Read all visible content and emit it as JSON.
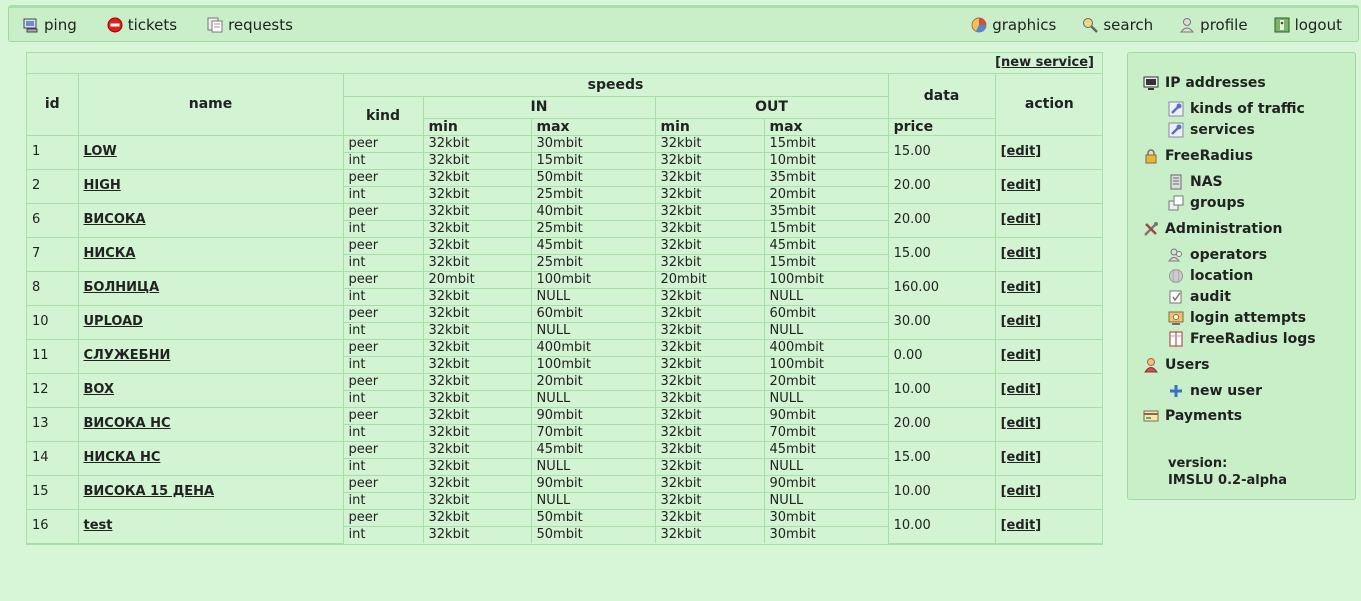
{
  "topnav": {
    "left": [
      {
        "label": "ping",
        "icon": "monitor-icon"
      },
      {
        "label": "tickets",
        "icon": "stop-icon"
      },
      {
        "label": "requests",
        "icon": "notes-icon"
      }
    ],
    "right": [
      {
        "label": "graphics",
        "icon": "chart-icon"
      },
      {
        "label": "search",
        "icon": "magnifier-icon"
      },
      {
        "label": "profile",
        "icon": "user-icon"
      },
      {
        "label": "logout",
        "icon": "exit-icon"
      }
    ]
  },
  "services": {
    "new_service_label": "[new service]",
    "headers": {
      "id": "id",
      "name": "name",
      "speeds": "speeds",
      "kind": "kind",
      "in": "IN",
      "out": "OUT",
      "min": "min",
      "max": "max",
      "data": "data",
      "price": "price",
      "action": "action"
    },
    "edit_label": "[edit]",
    "rows": [
      {
        "id": "1",
        "name": "LOW",
        "price": "15.00",
        "peer": [
          "peer",
          "32kbit",
          "30mbit",
          "32kbit",
          "15mbit"
        ],
        "int": [
          "int",
          "32kbit",
          "15mbit",
          "32kbit",
          "10mbit"
        ]
      },
      {
        "id": "2",
        "name": "HIGH",
        "price": "20.00",
        "peer": [
          "peer",
          "32kbit",
          "50mbit",
          "32kbit",
          "35mbit"
        ],
        "int": [
          "int",
          "32kbit",
          "25mbit",
          "32kbit",
          "20mbit"
        ]
      },
      {
        "id": "6",
        "name": "ВИСОКА",
        "price": "20.00",
        "peer": [
          "peer",
          "32kbit",
          "40mbit",
          "32kbit",
          "35mbit"
        ],
        "int": [
          "int",
          "32kbit",
          "25mbit",
          "32kbit",
          "15mbit"
        ]
      },
      {
        "id": "7",
        "name": "НИСКА",
        "price": "15.00",
        "peer": [
          "peer",
          "32kbit",
          "45mbit",
          "32kbit",
          "45mbit"
        ],
        "int": [
          "int",
          "32kbit",
          "25mbit",
          "32kbit",
          "15mbit"
        ]
      },
      {
        "id": "8",
        "name": "БОЛНИЦА",
        "price": "160.00",
        "peer": [
          "peer",
          "20mbit",
          "100mbit",
          "20mbit",
          "100mbit"
        ],
        "int": [
          "int",
          "32kbit",
          "NULL",
          "32kbit",
          "NULL"
        ]
      },
      {
        "id": "10",
        "name": "UPLOAD",
        "price": "30.00",
        "peer": [
          "peer",
          "32kbit",
          "60mbit",
          "32kbit",
          "60mbit"
        ],
        "int": [
          "int",
          "32kbit",
          "NULL",
          "32kbit",
          "NULL"
        ]
      },
      {
        "id": "11",
        "name": "СЛУЖЕБНИ",
        "price": "0.00",
        "peer": [
          "peer",
          "32kbit",
          "400mbit",
          "32kbit",
          "400mbit"
        ],
        "int": [
          "int",
          "32kbit",
          "100mbit",
          "32kbit",
          "100mbit"
        ]
      },
      {
        "id": "12",
        "name": "BOX",
        "price": "10.00",
        "peer": [
          "peer",
          "32kbit",
          "20mbit",
          "32kbit",
          "20mbit"
        ],
        "int": [
          "int",
          "32kbit",
          "NULL",
          "32kbit",
          "NULL"
        ]
      },
      {
        "id": "13",
        "name": "ВИСОКА НС",
        "price": "20.00",
        "peer": [
          "peer",
          "32kbit",
          "90mbit",
          "32kbit",
          "90mbit"
        ],
        "int": [
          "int",
          "32kbit",
          "70mbit",
          "32kbit",
          "70mbit"
        ]
      },
      {
        "id": "14",
        "name": "НИСКА НС",
        "price": "15.00",
        "peer": [
          "peer",
          "32kbit",
          "45mbit",
          "32kbit",
          "45mbit"
        ],
        "int": [
          "int",
          "32kbit",
          "NULL",
          "32kbit",
          "NULL"
        ]
      },
      {
        "id": "15",
        "name": "ВИСОКА 15 ДЕНА",
        "price": "10.00",
        "peer": [
          "peer",
          "32kbit",
          "90mbit",
          "32kbit",
          "90mbit"
        ],
        "int": [
          "int",
          "32kbit",
          "NULL",
          "32kbit",
          "NULL"
        ]
      },
      {
        "id": "16",
        "name": "test",
        "price": "10.00",
        "peer": [
          "peer",
          "32kbit",
          "50mbit",
          "32kbit",
          "30mbit"
        ],
        "int": [
          "int",
          "32kbit",
          "50mbit",
          "32kbit",
          "30mbit"
        ]
      }
    ]
  },
  "sidebar": {
    "items": [
      {
        "label": "IP addresses",
        "icon": "ip-icon",
        "level": 0
      },
      {
        "label": "kinds of traffic",
        "icon": "wrench-icon",
        "level": 1
      },
      {
        "label": "services",
        "icon": "wrench-icon",
        "level": 1
      },
      {
        "label": "FreeRadius",
        "icon": "lock-icon",
        "level": 0
      },
      {
        "label": "NAS",
        "icon": "server-icon",
        "level": 1
      },
      {
        "label": "groups",
        "icon": "group-icon",
        "level": 1
      },
      {
        "label": "Administration",
        "icon": "tools-icon",
        "level": 0
      },
      {
        "label": "operators",
        "icon": "operators-icon",
        "level": 1
      },
      {
        "label": "location",
        "icon": "globe-icon",
        "level": 1
      },
      {
        "label": "audit",
        "icon": "audit-icon",
        "level": 1
      },
      {
        "label": "login attempts",
        "icon": "login-icon",
        "level": 1
      },
      {
        "label": "FreeRadius logs",
        "icon": "book-icon",
        "level": 1
      },
      {
        "label": "Users",
        "icon": "users-icon",
        "level": 0
      },
      {
        "label": "new user",
        "icon": "plus-icon",
        "level": 1
      },
      {
        "label": "Payments",
        "icon": "payments-icon",
        "level": 0
      }
    ],
    "version_label": "version:",
    "version_value": "IMSLU 0.2-alpha"
  }
}
